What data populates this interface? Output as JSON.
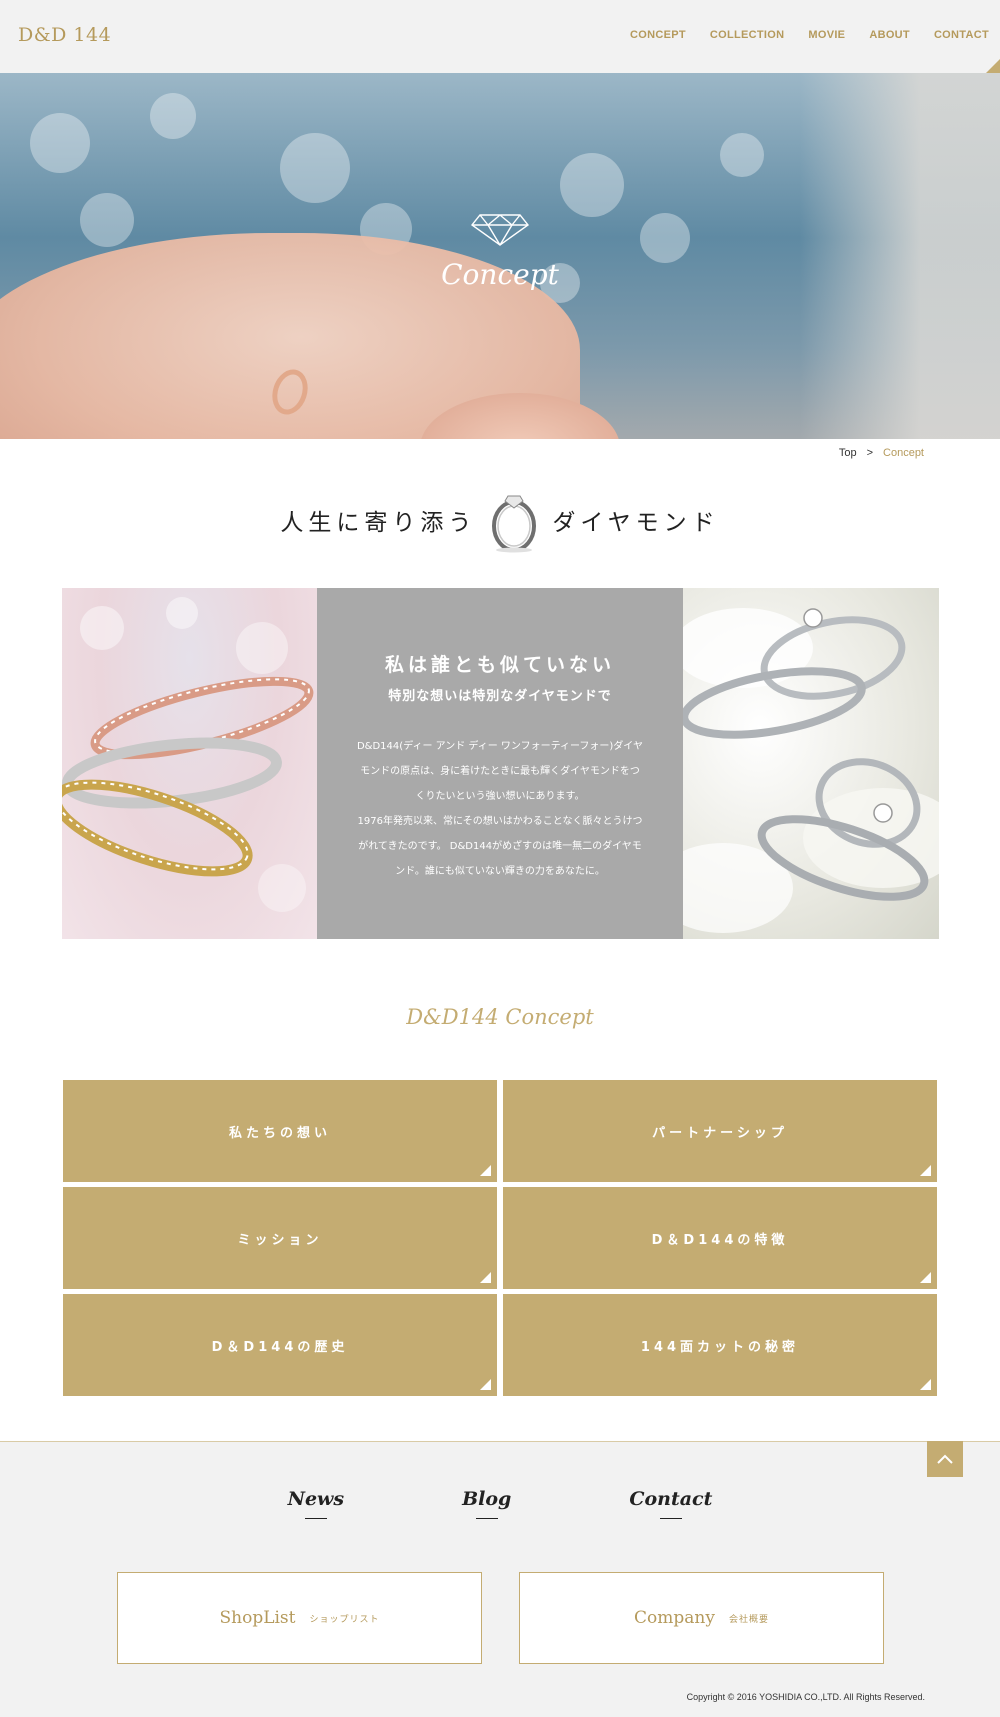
{
  "header": {
    "logo": "D&D 144",
    "nav": [
      "CONCEPT",
      "COLLECTION",
      "MOVIE",
      "ABOUT",
      "CONTACT"
    ]
  },
  "hero": {
    "title": "Concept"
  },
  "breadcrumb": {
    "top": "Top",
    "separator": ">",
    "current": "Concept"
  },
  "tagline": {
    "left": "人生に寄り添う",
    "right": "ダイヤモンド"
  },
  "feature": {
    "heading": "私は誰とも似ていない",
    "subheading": "特別な想いは特別なダイヤモンドで",
    "body": [
      "D&D144(ディー アンド ディー ワンフォーティーフォー)ダイヤ",
      "モンドの原点は、身に着けたときに最も輝くダイヤモンドをつ",
      "くりたいという強い想いにあります。",
      "1976年発売以来、常にその想いはかわることなく脈々とうけつ",
      "がれてきたのです。 D&D144がめざすのは唯一無二のダイヤモ",
      "ンド。誰にも似ていない輝きの力をあなたに。"
    ]
  },
  "concept_section": {
    "title": "D&D144 Concept",
    "tiles": [
      "私たちの想い",
      "パートナーシップ",
      "ミッション",
      "D＆D144の特徴",
      "D＆D144の歴史",
      "144面カットの秘密"
    ]
  },
  "footer": {
    "links": [
      "News",
      "Blog",
      "Contact"
    ],
    "shoplist": {
      "en": "ShopList",
      "jp": "ショップリスト"
    },
    "company": {
      "en": "Company",
      "jp": "会社概要"
    },
    "copyright": "Copyright © 2016 YOSHIDIA CO.,LTD. All Rights Reserved."
  },
  "colors": {
    "gold": "#c4ac72",
    "gray_panel": "#a9a9a9",
    "header_bg": "#f2f2f2"
  },
  "icons": [
    "diamond-icon",
    "ring-icon",
    "corner-arrow-icon",
    "chevron-up-icon"
  ]
}
